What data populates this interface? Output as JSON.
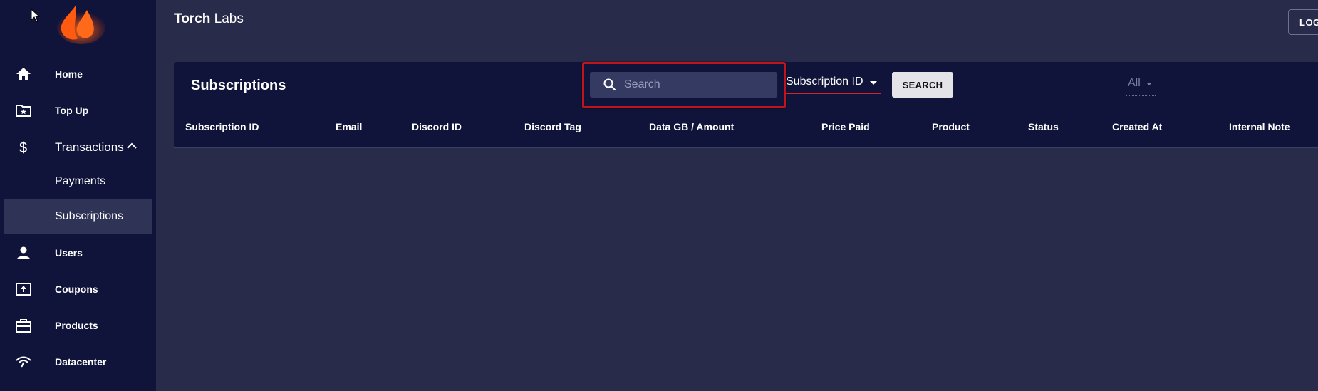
{
  "app": {
    "brand_bold": "Torch",
    "brand_rest": " Labs",
    "logout_label": "LOG"
  },
  "sidebar": {
    "items": [
      {
        "label": "Home",
        "icon": "home-icon"
      },
      {
        "label": "Top Up",
        "icon": "folder-star-icon"
      },
      {
        "label": "Transactions",
        "icon": "dollar-icon",
        "expanded": true
      },
      {
        "label": "Payments"
      },
      {
        "label": "Subscriptions",
        "active": true
      },
      {
        "label": "Users",
        "icon": "person-icon"
      },
      {
        "label": "Coupons",
        "icon": "upload-box-icon"
      },
      {
        "label": "Products",
        "icon": "briefcase-icon"
      },
      {
        "label": "Datacenter",
        "icon": "signal-icon"
      }
    ]
  },
  "main": {
    "title": "Subscriptions",
    "search": {
      "placeholder": "Search",
      "value": ""
    },
    "search_field_select": "Subscription ID",
    "search_button": "SEARCH",
    "status_filter": "All",
    "columns": [
      "Subscription ID",
      "Email",
      "Discord ID",
      "Discord Tag",
      "Data GB / Amount",
      "Price Paid",
      "Product",
      "Status",
      "Created At",
      "Internal Note"
    ]
  },
  "colors": {
    "sidebar_bg": "#10143a",
    "page_bg": "#282b4a",
    "card_bg": "#10143a",
    "accent_red": "#d8232a",
    "logo_orange": "#ff6a1a"
  }
}
